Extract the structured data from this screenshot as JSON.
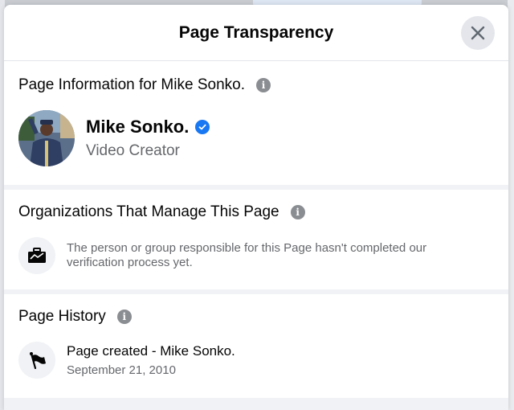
{
  "dialog": {
    "title": "Page Transparency"
  },
  "page_info": {
    "heading": "Page Information for Mike Sonko.",
    "name": "Mike Sonko.",
    "category": "Video Creator"
  },
  "organizations": {
    "heading": "Organizations That Manage This Page",
    "text": "The person or group responsible for this Page hasn't completed our verification process yet."
  },
  "history": {
    "heading": "Page History",
    "event": "Page created - Mike Sonko.",
    "date": "September 21, 2010"
  },
  "colors": {
    "accent": "#1877f2",
    "secondary_text": "#65676b",
    "info_icon": "#8a8d91"
  }
}
